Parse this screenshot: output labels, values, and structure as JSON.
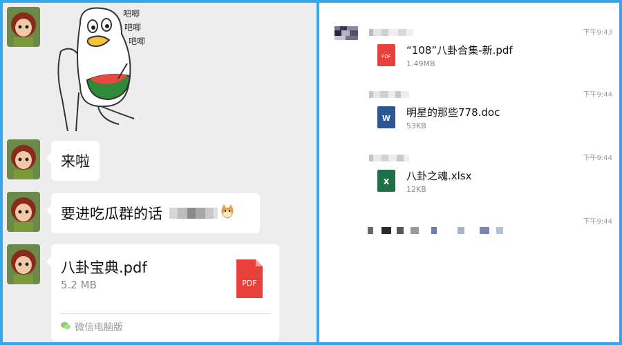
{
  "left_chat": {
    "sticker_texts": [
      "吧唧",
      "吧唧",
      "吧唧"
    ],
    "messages": [
      {
        "text": "来啦"
      },
      {
        "text": "要进吃瓜群的话"
      }
    ],
    "file_card": {
      "name": "八卦宝典.pdf",
      "size": "5.2 MB",
      "icon_label": "PDF",
      "source": "微信电脑版"
    }
  },
  "right_chat": {
    "files": [
      {
        "time": "下午9:43",
        "name": "“108”八卦合集-新.pdf",
        "size": "1.49MB",
        "type": "pdf",
        "icon_label": "PDF",
        "color": "#e8413b"
      },
      {
        "time": "下午9:44",
        "name": "明星的那些778.doc",
        "size": "53KB",
        "type": "doc",
        "icon_label": "W",
        "color": "#2b5797"
      },
      {
        "time": "下午9:44",
        "name": "八卦之魂.xlsx",
        "size": "12KB",
        "type": "xlsx",
        "icon_label": "X",
        "color": "#1e7145"
      }
    ],
    "last_time": "下午9:44"
  },
  "colors": {
    "frame": "#3aa6ea",
    "left_bg": "#ededed",
    "bubble": "#ffffff",
    "pdf_red": "#e8413b"
  }
}
